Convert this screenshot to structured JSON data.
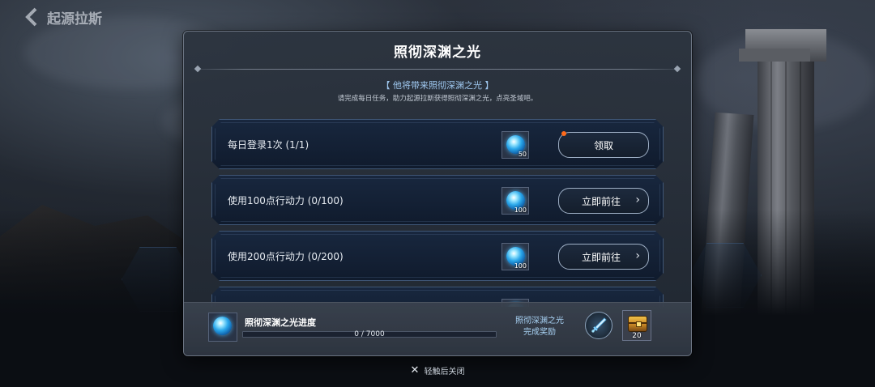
{
  "header": {
    "back_label": "起源拉斯"
  },
  "modal": {
    "title": "照彻深渊之光",
    "subtitle": "【 他将带来照彻深渊之光 】",
    "description": "请完成每日任务，助力起源拉斯获得照彻深渊之光，点亮圣域吧。",
    "tasks": [
      {
        "label": "每日登录1次 (1/1)",
        "reward_count": "50",
        "button": "领取",
        "has_arrow": false,
        "notify": true
      },
      {
        "label": "使用100点行动力 (0/100)",
        "reward_count": "100",
        "button": "立即前往",
        "has_arrow": true,
        "notify": false
      },
      {
        "label": "使用200点行动力 (0/200)",
        "reward_count": "100",
        "button": "立即前往",
        "has_arrow": true,
        "notify": false
      }
    ],
    "progress": {
      "title": "照彻深渊之光进度",
      "current": 0,
      "total": 7000,
      "text": "0 / 7000",
      "reward_label_line1": "照彻深渊之光",
      "reward_label_line2": "完成奖励",
      "chest_count": "20"
    }
  },
  "close_hint": "轻触后关闭",
  "colors": {
    "accent_blue": "#9fc8f0",
    "notify": "#ff6a1a"
  },
  "icons": {
    "back": "chevron-left-icon",
    "orb": "abyss-light-orb-icon",
    "sword": "sword-emblem-icon",
    "chest": "treasure-chest-icon",
    "close": "close-icon"
  }
}
